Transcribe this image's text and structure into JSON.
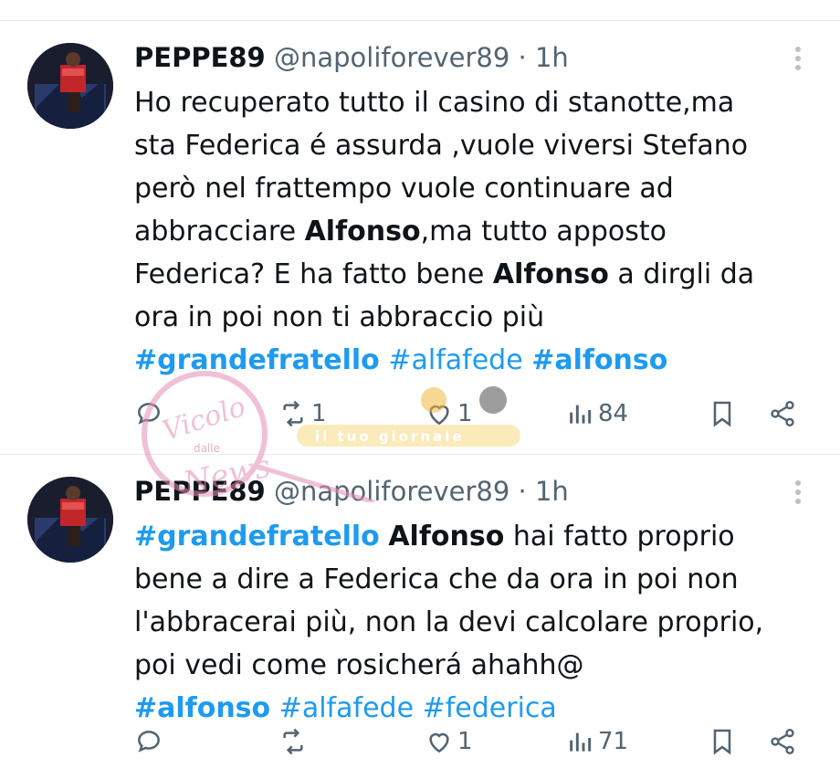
{
  "tweets": [
    {
      "name": "PEPPE89",
      "handle": "@napoliforever89",
      "separator": "·",
      "time": "1h",
      "lines": [
        [
          {
            "t": "Ho recuperato tutto il casino di stanotte,ma"
          }
        ],
        [
          {
            "t": "sta Federica é assurda ,vuole viversi Stefano"
          }
        ],
        [
          {
            "t": "però nel frattempo vuole continuare ad"
          }
        ],
        [
          {
            "t": "abbracciare "
          },
          {
            "t": "Alfonso",
            "bold": true
          },
          {
            "t": ",ma tutto apposto"
          }
        ],
        [
          {
            "t": "Federica? E ha fatto bene "
          },
          {
            "t": "Alfonso",
            "bold": true
          },
          {
            "t": " a dirgli da"
          }
        ],
        [
          {
            "t": "ora in poi non ti abbraccio più"
          }
        ],
        [
          {
            "t": "#grandefratello",
            "tag": true,
            "bold": true
          },
          {
            "t": " "
          },
          {
            "t": "#alfafede",
            "tag": true
          },
          {
            "t": " "
          },
          {
            "t": "#alfonso",
            "tag": true,
            "bold": true
          }
        ]
      ],
      "stats": {
        "replies": "",
        "reposts": "1",
        "likes": "1",
        "views": "84"
      }
    },
    {
      "name": "PEPPE89",
      "handle": "@napoliforever89",
      "separator": "·",
      "time": "1h",
      "lines": [
        [
          {
            "t": "#grandefratello",
            "tag": true,
            "bold": true
          },
          {
            "t": " "
          },
          {
            "t": "Alfonso",
            "bold": true
          },
          {
            "t": " hai fatto proprio"
          }
        ],
        [
          {
            "t": "bene a dire a Federica che da ora in poi non"
          }
        ],
        [
          {
            "t": "l'abbracerai più, non la devi calcolare proprio,"
          }
        ],
        [
          {
            "t": "poi vedi come rosicherá ahahh@"
          }
        ],
        [
          {
            "t": "#alfonso",
            "tag": true,
            "bold": true
          },
          {
            "t": " "
          },
          {
            "t": "#alfafede",
            "tag": true
          },
          {
            "t": " "
          },
          {
            "t": "#federica",
            "tag": true
          }
        ]
      ],
      "stats": {
        "replies": "",
        "reposts": "",
        "likes": "1",
        "views": "71"
      }
    }
  ],
  "watermark": {
    "brand": "Vicolo",
    "small": "dalle",
    "word": "News",
    "banner": "il tuo giornale"
  },
  "colors": {
    "link": "#1d9bf0",
    "muted": "#536471",
    "text": "#0f1419",
    "divider": "#e7e9ea"
  }
}
